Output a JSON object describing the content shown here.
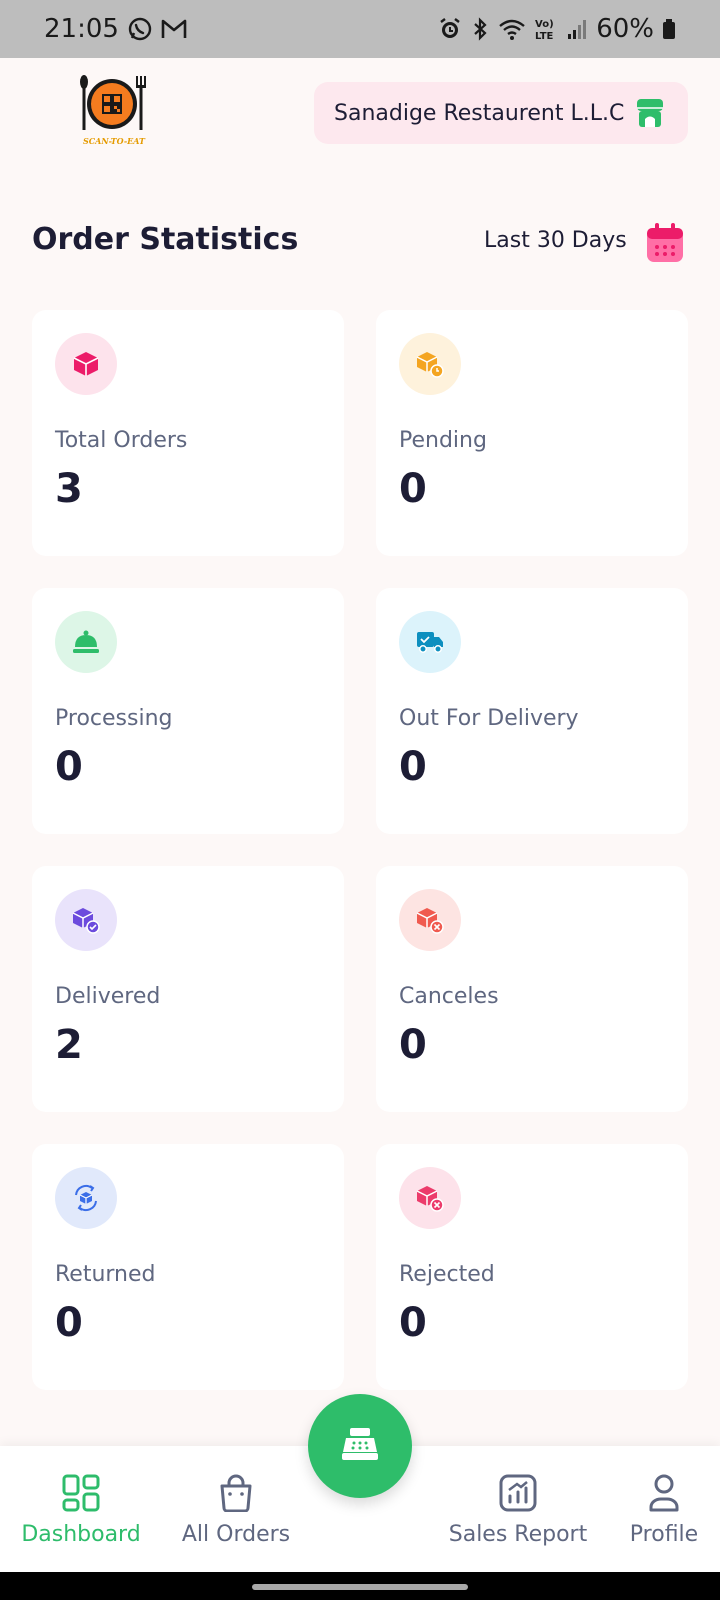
{
  "status_bar": {
    "time": "21:05",
    "battery": "60%",
    "icons_left": [
      "whatsapp-icon",
      "gmail-icon"
    ],
    "icons_right": [
      "alarm-icon",
      "bluetooth-icon",
      "wifi-icon",
      "volte-icon",
      "signal-icon",
      "battery-icon"
    ]
  },
  "header": {
    "logo_text": "SCAN-TO-EAT",
    "restaurant_name": "Sanadige Restaurent L.L.C",
    "restaurant_icon": "store-icon"
  },
  "section": {
    "title": "Order Statistics",
    "period": "Last 30 Days",
    "period_icon": "calendar-icon"
  },
  "stats": [
    {
      "label": "Total Orders",
      "value": "3",
      "icon": "box-icon",
      "color": "#ec1c69",
      "bg": "#fde3ec"
    },
    {
      "label": "Pending",
      "value": "0",
      "icon": "pending-box-icon",
      "color": "#f4a521",
      "bg": "#fef2dc"
    },
    {
      "label": "Processing",
      "value": "0",
      "icon": "bell-icon",
      "color": "#2ebd6a",
      "bg": "#ddf6e7"
    },
    {
      "label": "Out For Delivery",
      "value": "0",
      "icon": "truck-icon",
      "color": "#0d8fbf",
      "bg": "#dcf3fb"
    },
    {
      "label": "Delivered",
      "value": "2",
      "icon": "delivered-box-icon",
      "color": "#6c4bdd",
      "bg": "#e9e3fb"
    },
    {
      "label": "Canceles",
      "value": "0",
      "icon": "canceled-box-icon",
      "color": "#f05a4f",
      "bg": "#fde4e2"
    },
    {
      "label": "Returned",
      "value": "0",
      "icon": "returned-box-icon",
      "color": "#3b6ee8",
      "bg": "#e1e9fb"
    },
    {
      "label": "Rejected",
      "value": "0",
      "icon": "rejected-box-icon",
      "color": "#ec3b6b",
      "bg": "#fde2ea"
    }
  ],
  "nav": {
    "items": [
      {
        "label": "Dashboard",
        "icon": "dashboard-icon",
        "active": true
      },
      {
        "label": "All Orders",
        "icon": "bag-icon",
        "active": false
      },
      {
        "label": "Sales Report",
        "icon": "chart-icon",
        "active": false
      },
      {
        "label": "Profile",
        "icon": "user-icon",
        "active": false
      }
    ],
    "fab_icon": "cash-register-icon"
  },
  "colors": {
    "accent": "#2ebd6a",
    "text_primary": "#1d1d35",
    "text_secondary": "#5f6780",
    "background": "#fdf8f7"
  }
}
